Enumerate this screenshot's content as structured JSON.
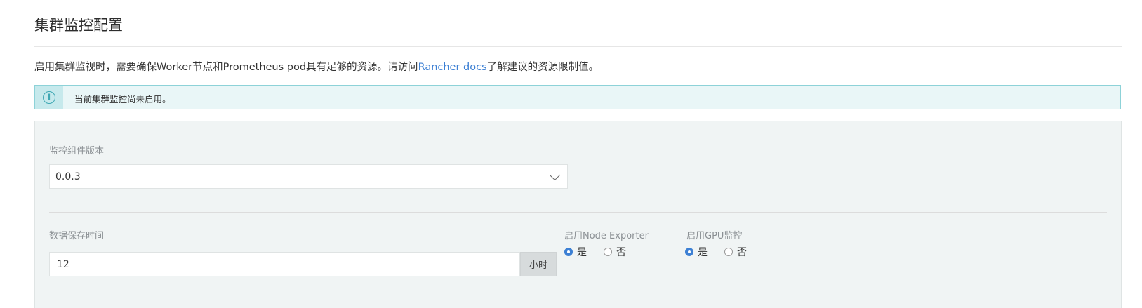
{
  "header": {
    "title": "集群监控配置"
  },
  "description": {
    "before_link": "启用集群监视时，需要确保Worker节点和Prometheus pod具有足够的资源。请访问",
    "link_text": "Rancher docs",
    "after_link": "了解建议的资源限制值。"
  },
  "info_banner": {
    "icon": "info-icon",
    "text": "当前集群监控尚未启用。"
  },
  "form": {
    "version": {
      "label": "监控组件版本",
      "value": "0.0.3"
    },
    "retention": {
      "label": "数据保存时间",
      "value": "12",
      "unit": "小时"
    },
    "node_exporter": {
      "label": "启用Node Exporter",
      "options": [
        "是",
        "否"
      ],
      "selected": "是"
    },
    "gpu_monitoring": {
      "label": "启用GPU监控",
      "options": [
        "是",
        "否"
      ],
      "selected": "是"
    }
  },
  "colors": {
    "accent": "#3d80d4",
    "info_border": "#8dd2d8",
    "info_bg": "#e9f6f7"
  }
}
